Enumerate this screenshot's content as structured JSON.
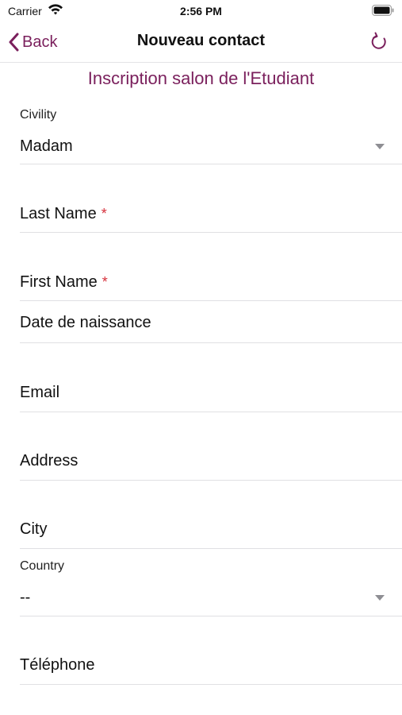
{
  "status_bar": {
    "carrier": "Carrier",
    "time": "2:56 PM"
  },
  "nav": {
    "back_label": "Back",
    "title": "Nouveau contact"
  },
  "form": {
    "header": "Inscription salon de l'Etudiant",
    "required_mark": "*",
    "civility": {
      "label": "Civility",
      "value": "Madam"
    },
    "last_name": {
      "placeholder": "Last Name"
    },
    "first_name": {
      "placeholder": "First Name"
    },
    "birth_date": {
      "placeholder": "Date de naissance"
    },
    "email": {
      "placeholder": "Email"
    },
    "address": {
      "placeholder": "Address"
    },
    "city": {
      "placeholder": "City"
    },
    "country": {
      "label": "Country",
      "value": "--"
    },
    "phone": {
      "placeholder": "Téléphone"
    }
  },
  "colors": {
    "accent": "#7a1f5c",
    "required": "#d6303b",
    "divider": "#e0e0e3"
  }
}
